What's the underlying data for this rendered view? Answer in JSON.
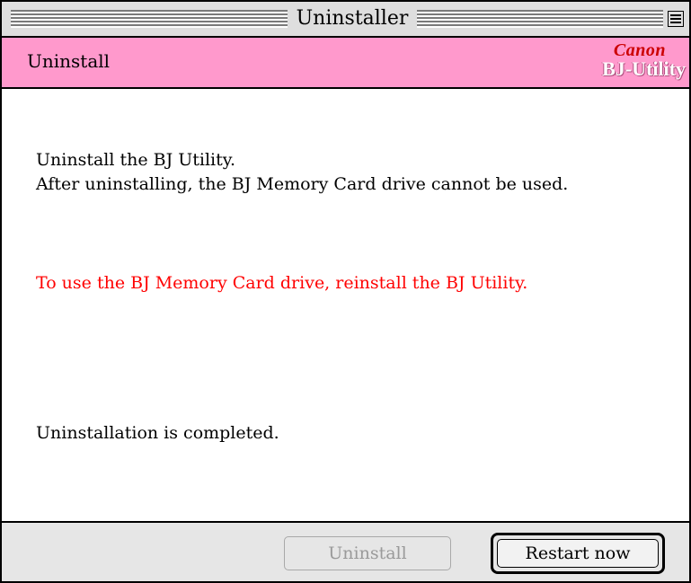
{
  "window": {
    "title": "Uninstaller"
  },
  "header": {
    "title": "Uninstall",
    "logo_brand": "Canon",
    "logo_product": "BJ-Utility",
    "background_color": "#ff99cc"
  },
  "content": {
    "line1": "Uninstall the BJ Utility.",
    "line2": "After uninstalling, the BJ Memory Card drive cannot be used.",
    "warning": "To use the BJ Memory Card drive, reinstall the BJ Utility.",
    "warning_color": "#ff0000",
    "status": "Uninstallation is completed."
  },
  "buttons": {
    "uninstall": {
      "label": "Uninstall",
      "enabled": false
    },
    "restart": {
      "label": "Restart now",
      "enabled": true,
      "default": true
    }
  }
}
